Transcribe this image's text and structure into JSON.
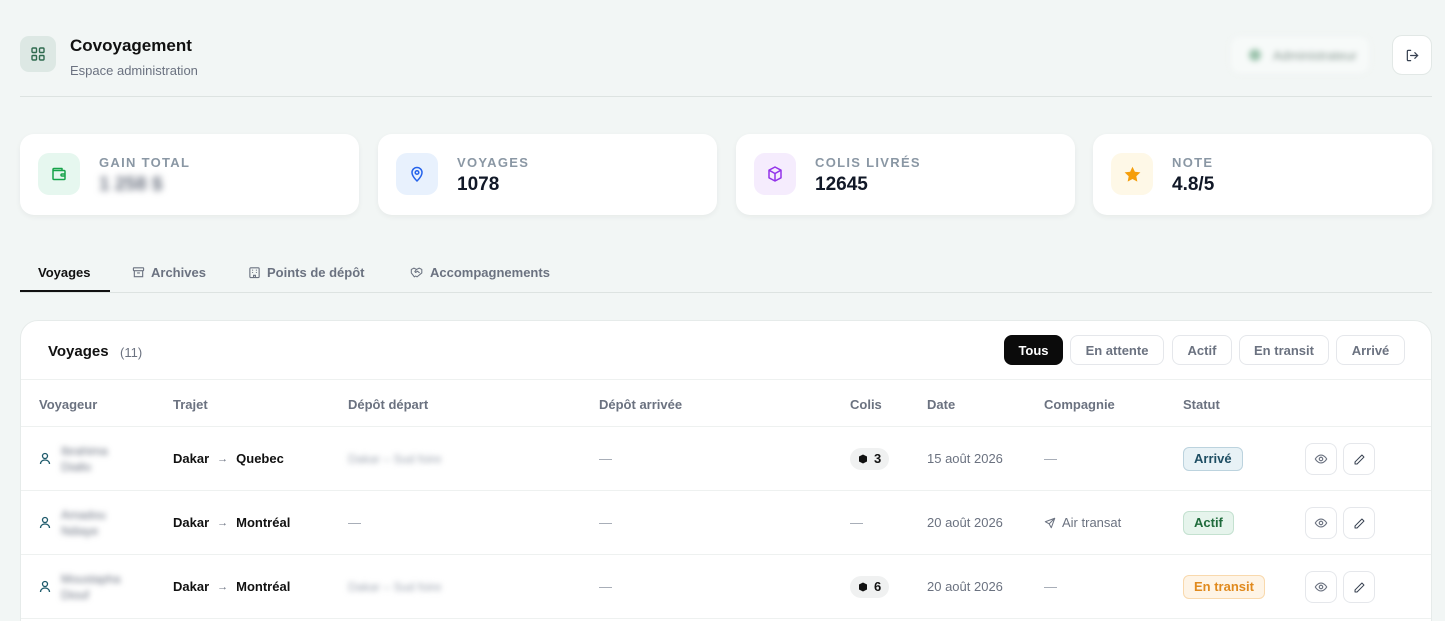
{
  "app": {
    "title": "Covoyagement",
    "subtitle": "Espace administration",
    "user_name": "Administrateur"
  },
  "stats": [
    {
      "label": "GAIN TOTAL",
      "value": "1 258 $",
      "icon": "wallet-icon",
      "icon_bg": "#e6f7ef",
      "icon_color": "#16a34a"
    },
    {
      "label": "VOYAGES",
      "value": "1078",
      "icon": "map-pin-icon",
      "icon_bg": "#e8f1fd",
      "icon_color": "#2563eb"
    },
    {
      "label": "COLIS LIVRÉS",
      "value": "12645",
      "icon": "package-icon",
      "icon_bg": "#f5ecfd",
      "icon_color": "#9333ea"
    },
    {
      "label": "NOTE",
      "value": "4.8/5",
      "icon": "star-icon",
      "icon_bg": "#fef8e7",
      "icon_color": "#f59e0b"
    }
  ],
  "tabs": [
    {
      "label": "Voyages",
      "icon": ""
    },
    {
      "label": "Archives",
      "icon": "archive-icon"
    },
    {
      "label": "Points de dépôt",
      "icon": "building-icon"
    },
    {
      "label": "Accompagnements",
      "icon": "handshake-icon"
    }
  ],
  "card": {
    "title": "Voyages",
    "count": "(11)",
    "filters": [
      "Tous",
      "En attente",
      "Actif",
      "En transit",
      "Arrivé"
    ],
    "active_filter": "Tous"
  },
  "columns": [
    "Voyageur",
    "Trajet",
    "Dépôt départ",
    "Dépôt arrivée",
    "Colis",
    "Date",
    "Compagnie",
    "Statut"
  ],
  "rows": [
    {
      "traveler": "Ibrahima Diallo",
      "from": "Dakar",
      "to": "Quebec",
      "depot_depart": "Dakar – Sud foire",
      "depot_arrivee": "—",
      "colis": "3",
      "date": "15 août 2026",
      "compagnie": "—",
      "statut": "Arrivé",
      "statut_style": "arrive"
    },
    {
      "traveler": "Amadou Ndiaye",
      "from": "Dakar",
      "to": "Montréal",
      "depot_depart": "—",
      "depot_arrivee": "—",
      "colis": "—",
      "date": "20 août 2026",
      "compagnie": "Air transat",
      "statut": "Actif",
      "statut_style": "actif"
    },
    {
      "traveler": "Moustapha Diouf",
      "from": "Dakar",
      "to": "Montréal",
      "depot_depart": "Dakar – Sud foire",
      "depot_arrivee": "—",
      "colis": "6",
      "date": "20 août 2026",
      "compagnie": "—",
      "statut": "En transit",
      "statut_style": "transit"
    }
  ],
  "status_colors": {
    "arrive": {
      "bg": "#e8f2f6",
      "border": "#bcd3de",
      "fg": "#1e4e63"
    },
    "actif": {
      "bg": "#e6f4ec",
      "border": "#c4e1d0",
      "fg": "#1f6b3c"
    },
    "transit": {
      "bg": "#fef4e6",
      "border": "#f9d9ad",
      "fg": "#e08a1e"
    }
  }
}
